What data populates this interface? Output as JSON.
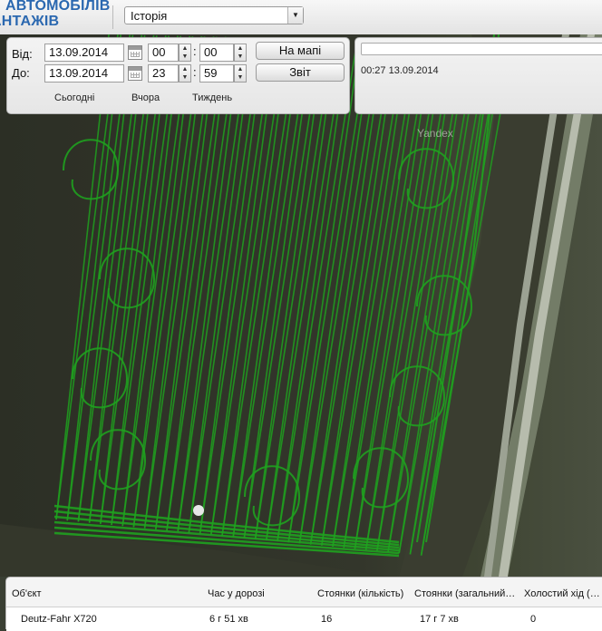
{
  "header": {
    "logo_line1": "АВТОМОБІЛІВ",
    "logo_line2": "АНТАЖІВ",
    "mode_select_value": "Історія"
  },
  "filter": {
    "from_label": "Від:",
    "to_label": "До:",
    "from_date": "13.09.2014",
    "from_hour": "00",
    "from_minute": "00",
    "to_date": "13.09.2014",
    "to_hour": "23",
    "to_minute": "59",
    "time_separator": ":",
    "on_map_button": "На мапі",
    "report_button": "Звіт",
    "quick_today": "Сьогодні",
    "quick_yesterday": "Вчора",
    "quick_week": "Тиждень"
  },
  "timeline": {
    "timestamp": "00:27 13.09.2014"
  },
  "map": {
    "watermark": "Yandex",
    "track_color": "#1fa11f"
  },
  "table": {
    "columns": [
      "Об'єкт",
      "Час у дорозі",
      "Стоянки (кількість)",
      "Стоянки (загальний…",
      "Холостий хід (…"
    ],
    "rows": [
      [
        "Deutz-Fahr X720",
        "6 г 51 хв",
        "16",
        "17 г 7 хв",
        "0"
      ]
    ]
  }
}
